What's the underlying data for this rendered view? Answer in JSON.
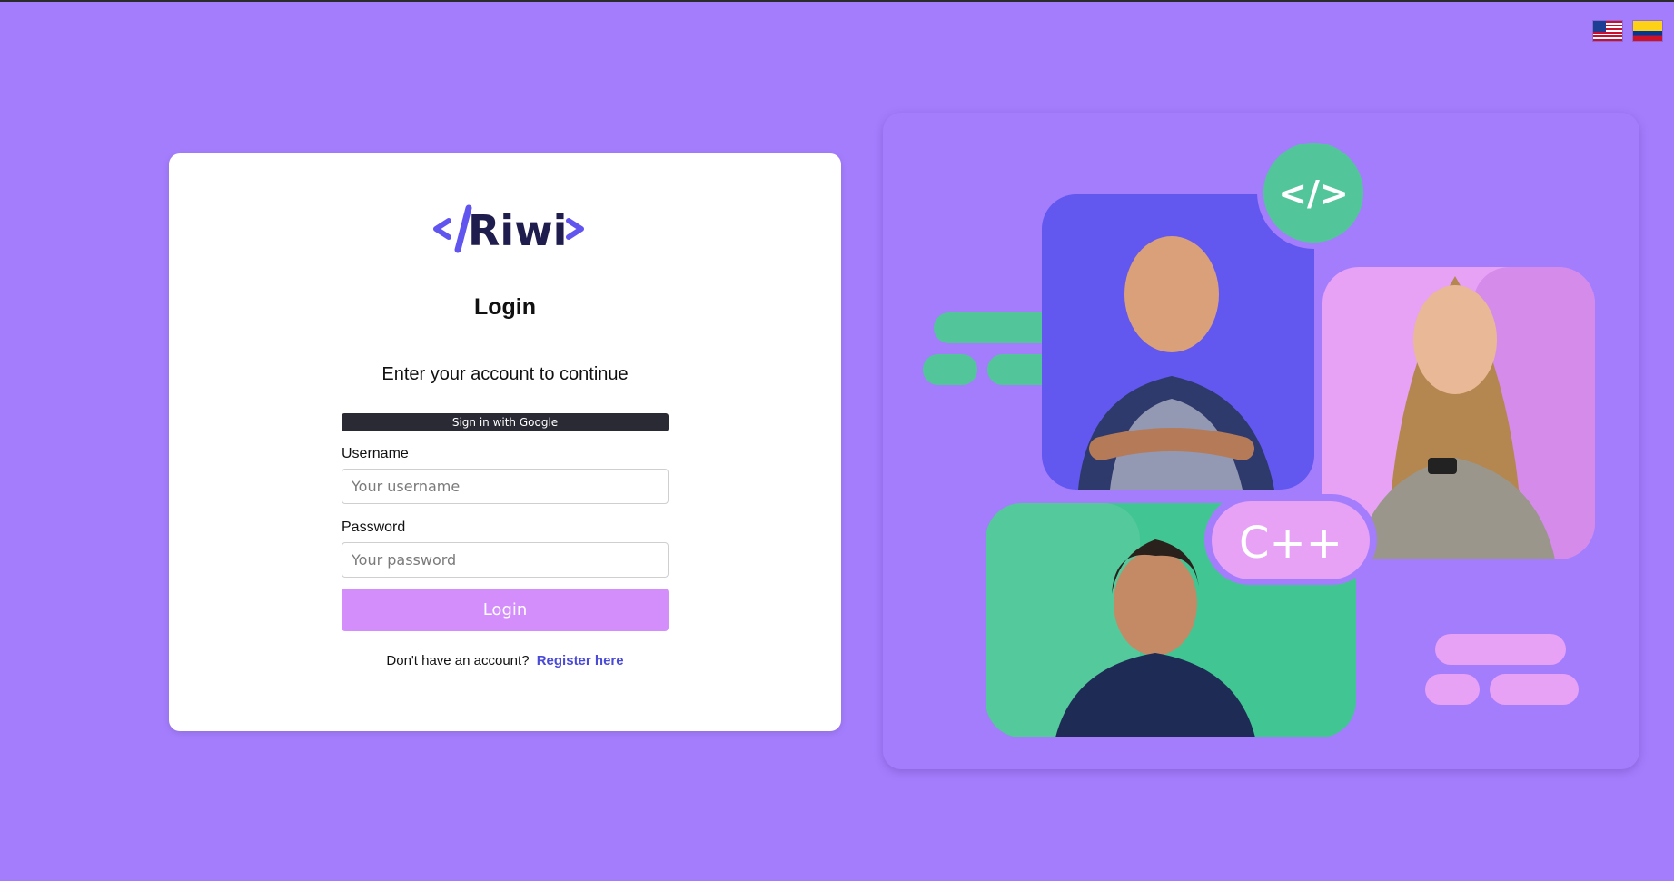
{
  "language_flags": [
    {
      "name": "us-flag-icon",
      "lang": "English"
    },
    {
      "name": "colombia-flag-icon",
      "lang": "Español"
    }
  ],
  "brand": {
    "logo_text": "</Riwi>"
  },
  "login": {
    "title": "Login",
    "subtitle": "Enter your account to continue",
    "google_button": "Sign in with Google",
    "username_label": "Username",
    "username_placeholder": "Your username",
    "password_label": "Password",
    "password_placeholder": "Your password",
    "submit_label": "Login",
    "register_prompt": "Don't have an account?",
    "register_link": "Register here"
  },
  "hero": {
    "code_badge": "</>",
    "cpp_badge": "C++"
  },
  "colors": {
    "background": "#a47dfd",
    "accent_purple": "#6155f0",
    "green": "#52c69a",
    "pink": "#e7a1f5",
    "login_button": "#d38efc",
    "link": "#4a4ad8"
  }
}
